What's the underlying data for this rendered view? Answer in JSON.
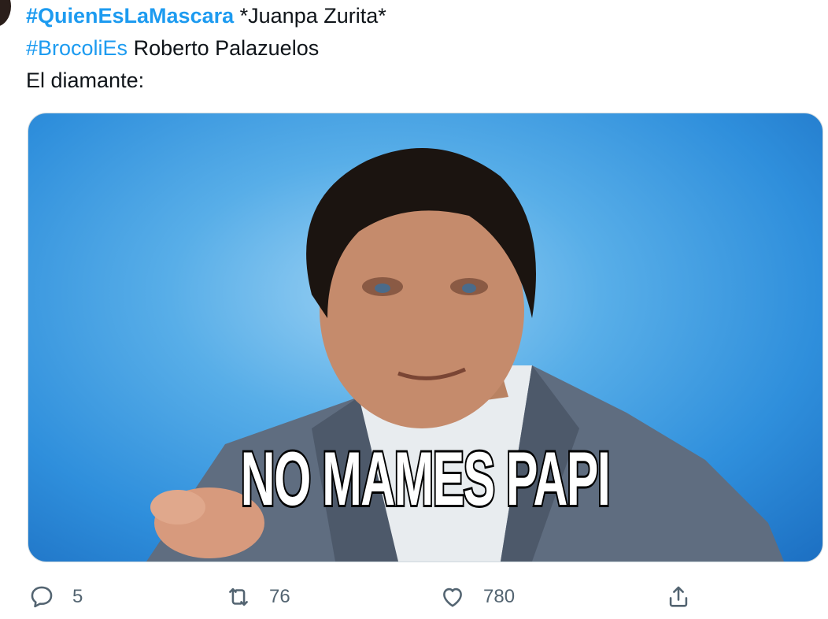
{
  "tweet": {
    "lines": [
      {
        "hashtag": "#QuienEsLaMascara",
        "text": " *Juanpa Zurita*"
      },
      {
        "hashtag": "#BrocoliEs",
        "text": " Roberto Palazuelos"
      },
      {
        "text": "El diamante:"
      }
    ]
  },
  "media": {
    "meme_caption": "NO MAMES PAPI",
    "background_color": "#3a9ae3"
  },
  "actions": {
    "reply_count": "5",
    "retweet_count": "76",
    "like_count": "780"
  },
  "icons": {
    "reply": "reply-icon",
    "retweet": "retweet-icon",
    "like": "heart-icon",
    "share": "share-icon"
  },
  "colors": {
    "hashtag": "#1d9bf0",
    "muted": "#536471"
  }
}
